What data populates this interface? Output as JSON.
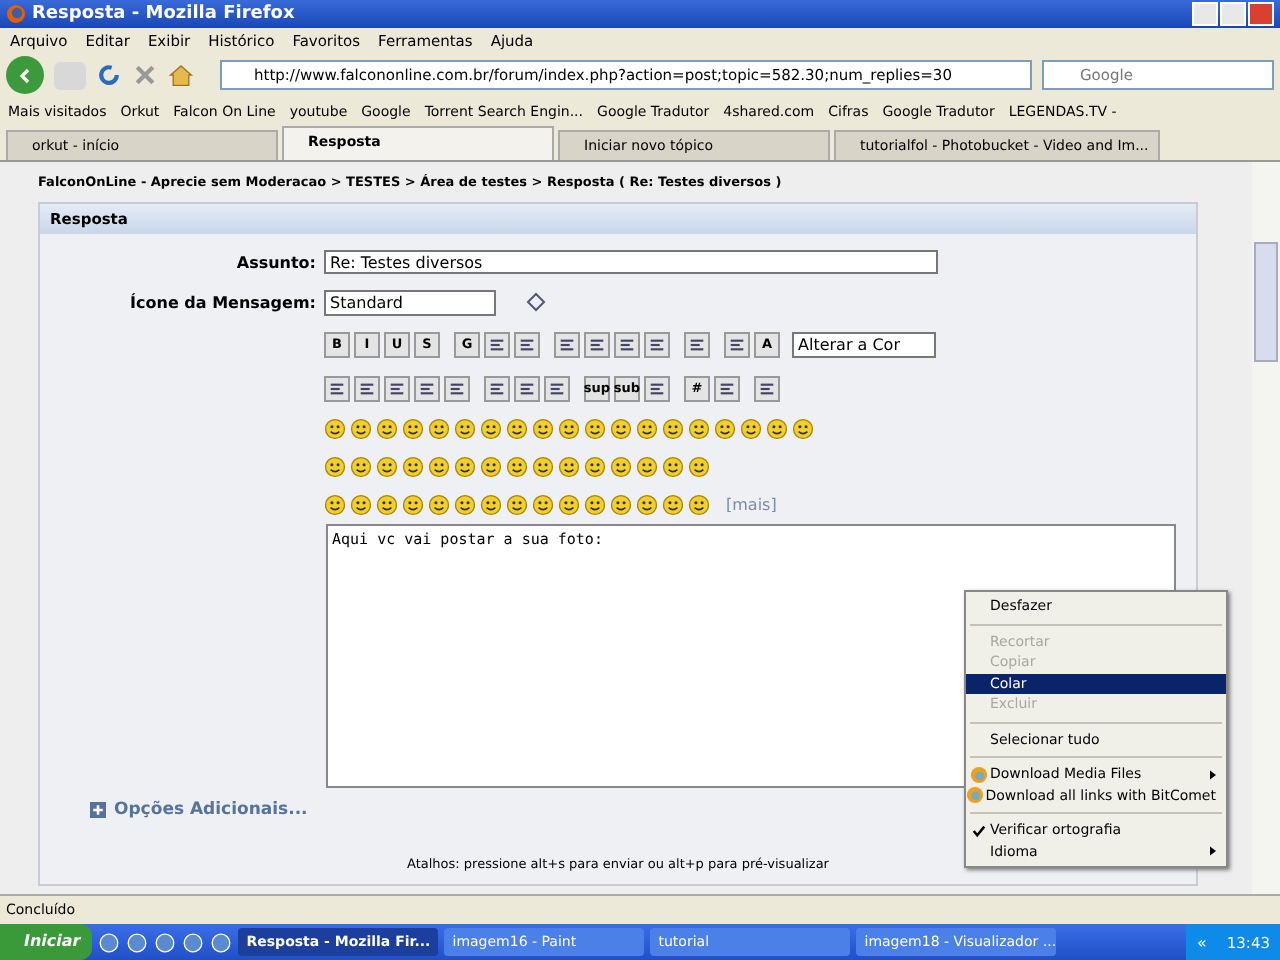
{
  "window": {
    "title": "Resposta - Mozilla Firefox"
  },
  "menu": [
    "Arquivo",
    "Editar",
    "Exibir",
    "Histórico",
    "Favoritos",
    "Ferramentas",
    "Ajuda"
  ],
  "address": {
    "value": "http://www.falcononline.com.br/forum/index.php?action=post;topic=582.30;num_replies=30"
  },
  "search": {
    "placeholder": "Google"
  },
  "bookmarks": [
    "Mais visitados",
    "Orkut",
    "Falcon On Line",
    "youtube",
    "Google",
    "Torrent Search Engin...",
    "Google Tradutor",
    "4shared.com",
    "Cifras",
    "Google Tradutor",
    "LEGENDAS.TV -"
  ],
  "tabs": [
    {
      "label": "orkut - início",
      "selected": false
    },
    {
      "label": "Resposta",
      "selected": true
    },
    {
      "label": "Iniciar novo tópico",
      "selected": false
    },
    {
      "label": "tutorialfol - Photobucket - Video and Im...",
      "selected": false
    }
  ],
  "breadcrumb": "FalconOnLine - Aprecie sem Moderacao > TESTES > Área de testes > Resposta ( Re: Testes diversos )",
  "panel": {
    "title": "Resposta",
    "subject_label": "Assunto:",
    "subject_value": "Re: Testes diversos",
    "icon_label": "Ícone da Mensagem:",
    "icon_value": "Standard",
    "color_select": "Alterar a Cor",
    "toolbar_rows": [
      [
        {
          "kind": "text",
          "label": "B"
        },
        {
          "kind": "text",
          "label": "I"
        },
        {
          "kind": "text",
          "label": "U"
        },
        {
          "kind": "text",
          "label": "S"
        },
        {
          "kind": "sep"
        },
        {
          "kind": "text",
          "label": "G"
        },
        {
          "kind": "icon"
        },
        {
          "kind": "icon"
        },
        {
          "kind": "sep"
        },
        {
          "kind": "icon"
        },
        {
          "kind": "icon"
        },
        {
          "kind": "icon"
        },
        {
          "kind": "icon"
        },
        {
          "kind": "sep"
        },
        {
          "kind": "icon"
        },
        {
          "kind": "sep"
        },
        {
          "kind": "icon"
        },
        {
          "kind": "text",
          "label": "A"
        }
      ],
      [
        {
          "kind": "icon"
        },
        {
          "kind": "icon"
        },
        {
          "kind": "icon"
        },
        {
          "kind": "icon"
        },
        {
          "kind": "icon"
        },
        {
          "kind": "sep"
        },
        {
          "kind": "icon"
        },
        {
          "kind": "icon"
        },
        {
          "kind": "icon"
        },
        {
          "kind": "sep"
        },
        {
          "kind": "text",
          "label": "sup"
        },
        {
          "kind": "text",
          "label": "sub"
        },
        {
          "kind": "icon"
        },
        {
          "kind": "sep"
        },
        {
          "kind": "text",
          "label": "#"
        },
        {
          "kind": "icon"
        },
        {
          "kind": "sep"
        },
        {
          "kind": "icon"
        }
      ]
    ],
    "more_link": "[mais]",
    "message": "Aqui vc vai postar a sua foto:",
    "additional": "Opções Adicionais...",
    "shortcuts": "Atalhos: pressione alt+s para enviar ou alt+p para pré-visualizar"
  },
  "context_menu": [
    {
      "kind": "item",
      "label": "Desfazer",
      "disabled": false,
      "selected": false,
      "checked": false,
      "submenu": false
    },
    {
      "kind": "separator"
    },
    {
      "kind": "item",
      "label": "Recortar",
      "disabled": true,
      "selected": false,
      "checked": false,
      "submenu": false
    },
    {
      "kind": "item",
      "label": "Copiar",
      "disabled": true,
      "selected": false,
      "checked": false,
      "submenu": false
    },
    {
      "kind": "item",
      "label": "Colar",
      "disabled": false,
      "selected": true,
      "checked": false,
      "submenu": false
    },
    {
      "kind": "item",
      "label": "Excluir",
      "disabled": true,
      "selected": false,
      "checked": false,
      "submenu": false
    },
    {
      "kind": "separator"
    },
    {
      "kind": "item",
      "label": "Selecionar tudo",
      "disabled": false,
      "selected": false,
      "checked": false,
      "submenu": false
    },
    {
      "kind": "separator"
    },
    {
      "kind": "app",
      "label": "Download Media Files",
      "disabled": false,
      "selected": false,
      "checked": false,
      "submenu": true
    },
    {
      "kind": "app",
      "label": "Download all links with BitComet",
      "disabled": false,
      "selected": false,
      "checked": false,
      "submenu": false
    },
    {
      "kind": "separator"
    },
    {
      "kind": "item",
      "label": "Verificar ortografia",
      "disabled": false,
      "selected": false,
      "checked": true,
      "submenu": false
    },
    {
      "kind": "item",
      "label": "Idioma",
      "disabled": false,
      "selected": false,
      "checked": false,
      "submenu": true
    }
  ],
  "status_bar": "Concluído",
  "taskbar": {
    "start": "Iniciar",
    "windows": [
      {
        "label": "Resposta - Mozilla Fir...",
        "selected": true
      },
      {
        "label": "imagem16 - Paint",
        "selected": false
      },
      {
        "label": "tutorial",
        "selected": false
      },
      {
        "label": "imagem18 - Visualizador ...",
        "selected": false
      }
    ],
    "tray": "«",
    "clock": "13:43"
  }
}
